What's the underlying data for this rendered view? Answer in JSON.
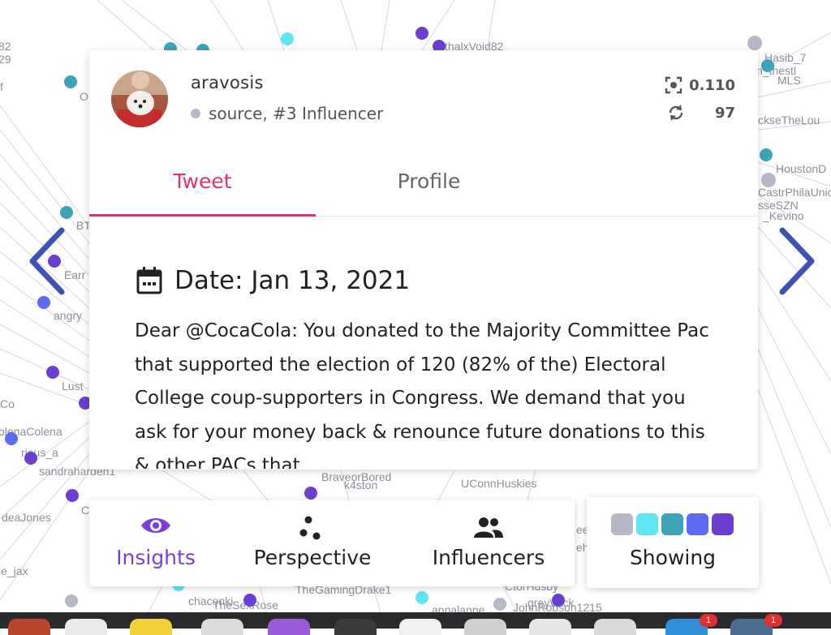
{
  "colors": {
    "accent": "#e0336a",
    "insights": "#7b3fd6",
    "arrow": "#3f51b5",
    "node_purple": "#6b3fd0",
    "node_teal": "#3fa3b8",
    "node_cyan": "#5fe6f2",
    "node_gray": "#b6b8c8",
    "node_blue": "#5d6cf0"
  },
  "graph": {
    "labels": [
      "82",
      "29",
      "thalxVoid82",
      "Hasib_7",
      "n_thestl",
      "MLS",
      "ckseTheLou",
      "HoustonD",
      "CastrPhilaUnic",
      "sseSZN",
      "_Kevino",
      "BT",
      "Earr",
      "angry",
      "Lust",
      "Co",
      "olenaColena",
      "rious_a",
      "sandraharden1",
      "deaJones",
      "ie_jax",
      "C",
      "BraveorBored",
      "k4ston",
      "UConnHuskies",
      "TheGamingDrake1",
      "chaconki",
      "TheSexRose",
      "CtorHusby",
      "greyWick",
      "JohnRobson1215",
      "annalanne",
      "O",
      "ee",
      "eh",
      "f"
    ]
  },
  "navigation": {
    "prev_icon": "chevron-left-icon",
    "next_icon": "chevron-right-icon"
  },
  "card": {
    "username": "aravosis",
    "role": "source, #3 Influencer",
    "score": "0.110",
    "retweets": "97",
    "tabs": [
      "Tweet",
      "Profile"
    ],
    "active_tab": "Tweet",
    "date_label": "Date: Jan 13, 2021",
    "tweet_text": "Dear @CocaCola: You donated to the Majority Committee Pac that supported the election of 120 (82% of the) Electoral College coup-supporters in Congress. We demand that you ask for your money back & renounce future donations to this & other PACs that"
  },
  "toolbar": {
    "insights_label": "Insights",
    "perspective_label": "Perspective",
    "influencers_label": "Influencers"
  },
  "showing": {
    "label": "Showing",
    "swatch_colors": [
      "#b6b8c8",
      "#5fe6f2",
      "#3fa3b8",
      "#5d6cf0",
      "#6b3fd0"
    ]
  },
  "dock": {
    "badges": [
      "1",
      "1"
    ]
  }
}
